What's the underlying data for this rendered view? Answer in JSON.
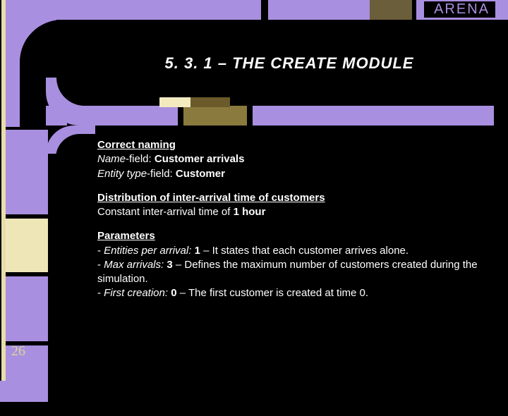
{
  "header": {
    "brand": "ARENA"
  },
  "slide": {
    "title": "5. 3. 1 – THE CREATE MODULE",
    "page_number": "26"
  },
  "sections": {
    "naming": {
      "heading": "Correct naming",
      "name_label": "Name",
      "name_suffix": "-field: ",
      "name_value": "Customer arrivals",
      "entity_label": "Entity type",
      "entity_suffix": "-field: ",
      "entity_value": "Customer"
    },
    "distribution": {
      "heading": "Distribution of inter-arrival time of customers",
      "line_prefix": "Constant inter-arrival time of ",
      "line_value": "1 hour"
    },
    "parameters": {
      "heading": "Parameters",
      "p1_label": "Entities per arrival:",
      "p1_value": "1",
      "p1_desc": " – It states that each customer arrives alone.",
      "p2_label": "Max arrivals:",
      "p2_value": "3",
      "p2_desc": " – Defines the maximum number of customers created during the simulation.",
      "p3_label": "First creation:",
      "p3_value": "0",
      "p3_desc": " – The first customer is created at time 0."
    }
  }
}
